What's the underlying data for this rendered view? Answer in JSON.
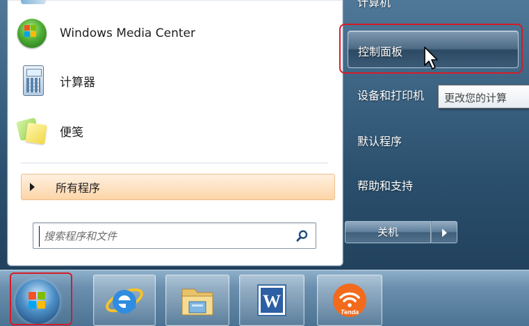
{
  "start_menu": {
    "programs": [
      {
        "label": "Windows Media Center",
        "icon": "windows-media-center-icon"
      },
      {
        "label": "计算器",
        "icon": "calculator-icon"
      },
      {
        "label": "便笺",
        "icon": "sticky-notes-icon"
      }
    ],
    "all_programs_label": "所有程序",
    "search_placeholder": "搜索程序和文件"
  },
  "right_panel": {
    "top_partial": "计算机",
    "control_panel": "控制面板",
    "devices": "设备和打印机",
    "default_programs": "默认程序",
    "help": "帮助和支持",
    "shutdown": "关机"
  },
  "tooltip": "更改您的计算",
  "taskbar": {
    "items": [
      "start-orb",
      "internet-explorer-icon",
      "windows-explorer-icon",
      "word-icon",
      "tenda-icon"
    ],
    "word_letter": "W",
    "tenda_label": "Tenda"
  },
  "colors": {
    "highlight_red": "#d41b25",
    "all_programs_bg": "#fcd5a8",
    "panel_blue": "#2a4f6d"
  }
}
